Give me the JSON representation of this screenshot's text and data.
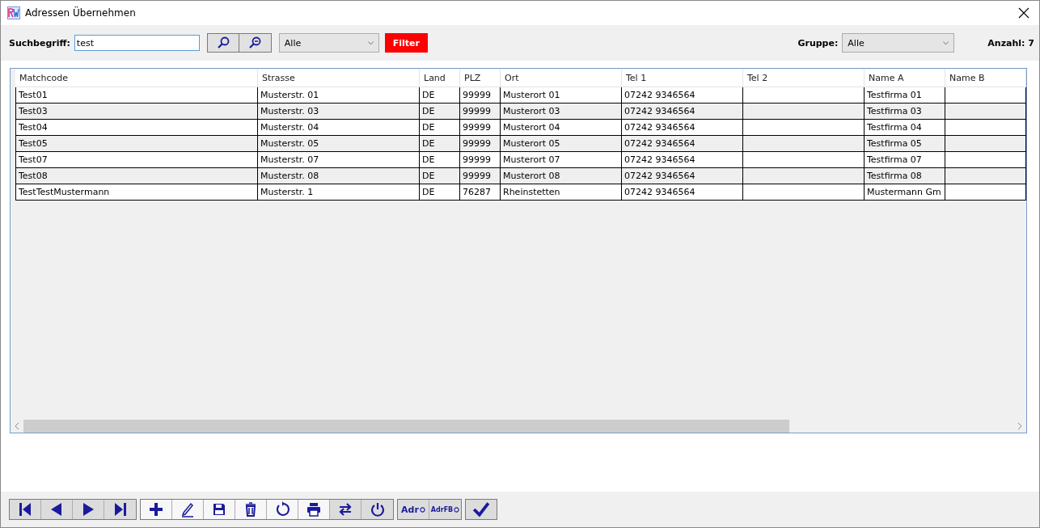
{
  "window": {
    "title": "Adressen Übernehmen"
  },
  "search": {
    "label": "Suchbegriff:",
    "value": "test",
    "scope": "Alle",
    "filter_button": "Filter"
  },
  "group": {
    "label": "Gruppe:",
    "value": "Alle"
  },
  "count": "Anzahl: 7",
  "table": {
    "columns": [
      "Matchcode",
      "Strasse",
      "Land",
      "PLZ",
      "Ort",
      "Tel 1",
      "Tel 2",
      "Name A",
      "Name B"
    ],
    "rows": [
      [
        "Test01",
        "Musterstr. 01",
        "DE",
        "99999",
        "Musterort 01",
        "07242 9346564",
        "",
        "Testfirma 01",
        ""
      ],
      [
        "Test03",
        "Musterstr. 03",
        "DE",
        "99999",
        "Musterort 03",
        "07242 9346564",
        "",
        "Testfirma 03",
        ""
      ],
      [
        "Test04",
        "Musterstr. 04",
        "DE",
        "99999",
        "Musterort 04",
        "07242 9346564",
        "",
        "Testfirma 04",
        ""
      ],
      [
        "Test05",
        "Musterstr. 05",
        "DE",
        "99999",
        "Musterort 05",
        "07242 9346564",
        "",
        "Testfirma 05",
        ""
      ],
      [
        "Test07",
        "Musterstr. 07",
        "DE",
        "99999",
        "Musterort 07",
        "07242 9346564",
        "",
        "Testfirma 07",
        ""
      ],
      [
        "Test08",
        "Musterstr. 08",
        "DE",
        "99999",
        "Musterort 08",
        "07242 9346564",
        "",
        "Testfirma 08",
        ""
      ],
      [
        "TestTestMustermann",
        "Musterstr. 1",
        "DE",
        "76287",
        "Rheinstetten",
        "07242 9346564",
        "",
        "Mustermann Gm",
        ""
      ]
    ]
  },
  "toolbar": [
    {
      "kind": "first",
      "shaded": true
    },
    {
      "kind": "prev",
      "shaded": true
    },
    {
      "kind": "next",
      "shaded": true
    },
    {
      "kind": "last",
      "shaded": true
    },
    {
      "kind": "add",
      "shaded": false
    },
    {
      "kind": "edit",
      "shaded": false
    },
    {
      "kind": "save",
      "shaded": false
    },
    {
      "kind": "delete",
      "shaded": false
    },
    {
      "kind": "refresh",
      "shaded": false
    },
    {
      "kind": "print",
      "shaded": false
    },
    {
      "kind": "swap",
      "shaded": true
    },
    {
      "kind": "power",
      "shaded": true
    },
    {
      "kind": "text",
      "label": "Adr",
      "shaded": true
    },
    {
      "kind": "text",
      "label": "AdrFB",
      "shaded": true
    },
    {
      "kind": "check",
      "shaded": true
    }
  ]
}
